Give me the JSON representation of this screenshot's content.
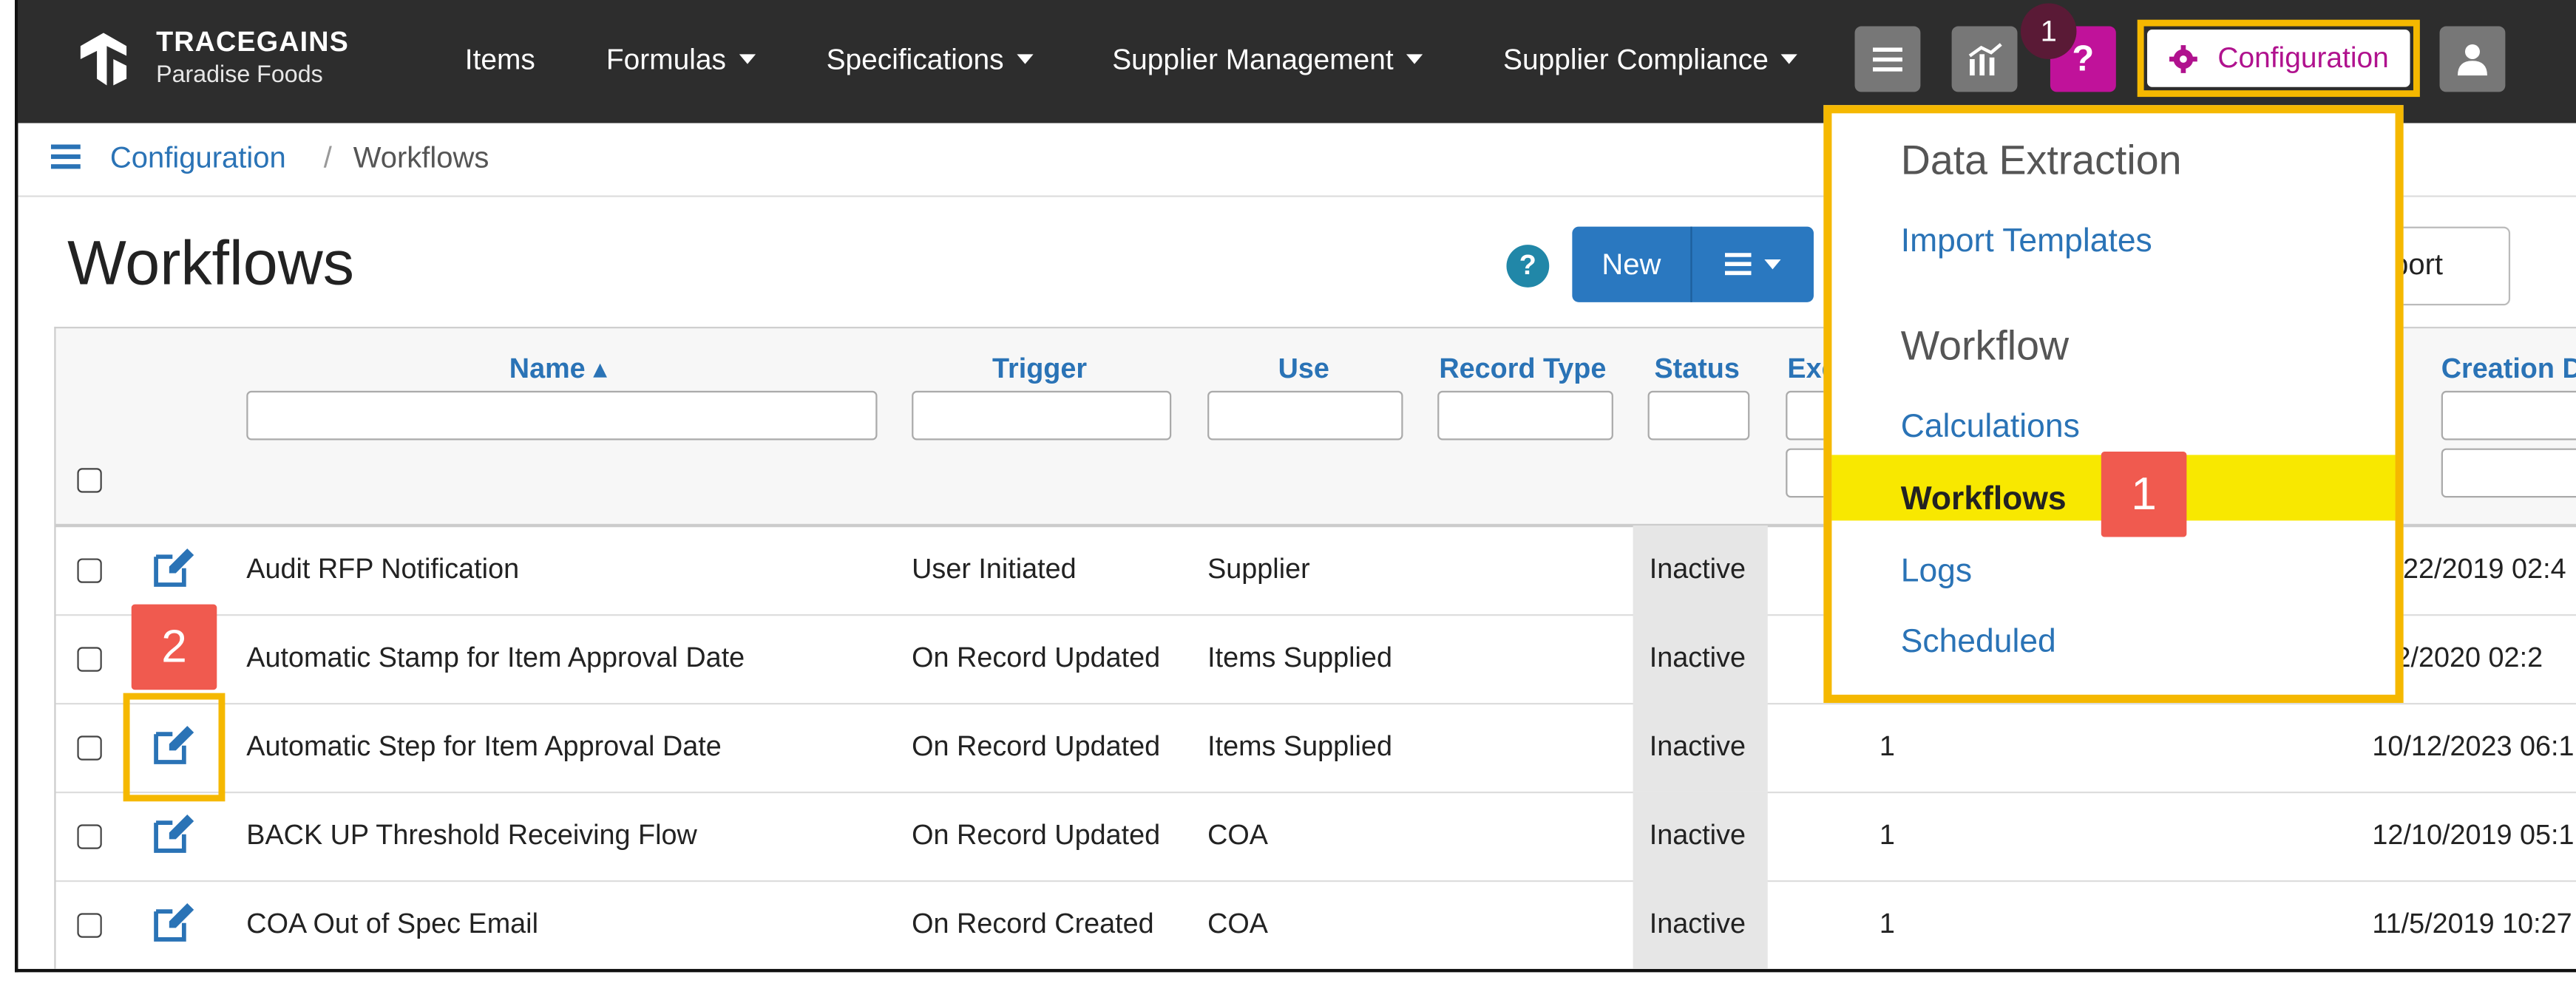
{
  "header": {
    "brand": "TRACEGAINS",
    "brand_sub": "Paradise Foods",
    "nav": {
      "items": "Items",
      "formulas": "Formulas",
      "specifications": "Specifications",
      "supplier_management": "Supplier Management",
      "supplier_compliance": "Supplier Compliance"
    },
    "notification_count": "1",
    "help_label": "?",
    "configuration_label": "Configuration"
  },
  "breadcrumb": {
    "parent": "Configuration",
    "separator": "/",
    "current": "Workflows"
  },
  "page": {
    "title": "Workflows",
    "help_label": "?",
    "new_label": "New",
    "export_label": "xport"
  },
  "table": {
    "columns": {
      "name": "Name ▴",
      "trigger": "Trigger",
      "use": "Use",
      "record_type": "Record Type",
      "status": "Status",
      "exec": "Exe",
      "creation": "Creation D"
    },
    "rows": [
      {
        "name": "Audit RFP Notification",
        "trigger": "User Initiated",
        "use": "Supplier",
        "status": "Inactive",
        "exec": "",
        "created": "/22/2019 02:4"
      },
      {
        "name": "Automatic Stamp for Item Approval Date",
        "trigger": "On Record Updated",
        "use": "Items Supplied",
        "status": "Inactive",
        "exec": "",
        "created": "2/2020 02:2"
      },
      {
        "name": "Automatic Step for Item Approval Date",
        "trigger": "On Record Updated",
        "use": "Items Supplied",
        "status": "Inactive",
        "exec": "1",
        "created": "10/12/2023 06:1"
      },
      {
        "name": "BACK UP Threshold Receiving Flow",
        "trigger": "On Record Updated",
        "use": "COA",
        "status": "Inactive",
        "exec": "1",
        "created": "12/10/2019 05:1"
      },
      {
        "name": "COA Out of Spec Email",
        "trigger": "On Record Created",
        "use": "COA",
        "status": "Inactive",
        "exec": "1",
        "created": "11/5/2019 10:27"
      }
    ]
  },
  "config_menu": {
    "section1": "Data Extraction",
    "import_templates": "Import Templates",
    "section2": "Workflow",
    "calculations": "Calculations",
    "workflows": "Workflows",
    "logs": "Logs",
    "scheduled": "Scheduled"
  },
  "callouts": {
    "step1": "1",
    "step2": "2"
  },
  "colors": {
    "topbar": "#2d2d2d",
    "link": "#2a73b6",
    "highlight": "#f8e800",
    "callout_border": "#f5b800",
    "callout_badge": "#f05a4f",
    "help_magenta": "#c0129a"
  },
  "icons": [
    "tracegains-logo-icon",
    "hamburger-icon",
    "analytics-icon",
    "help-icon",
    "gear-icon",
    "user-icon",
    "edit-icon",
    "caret-down-icon",
    "sort-up-icon"
  ]
}
